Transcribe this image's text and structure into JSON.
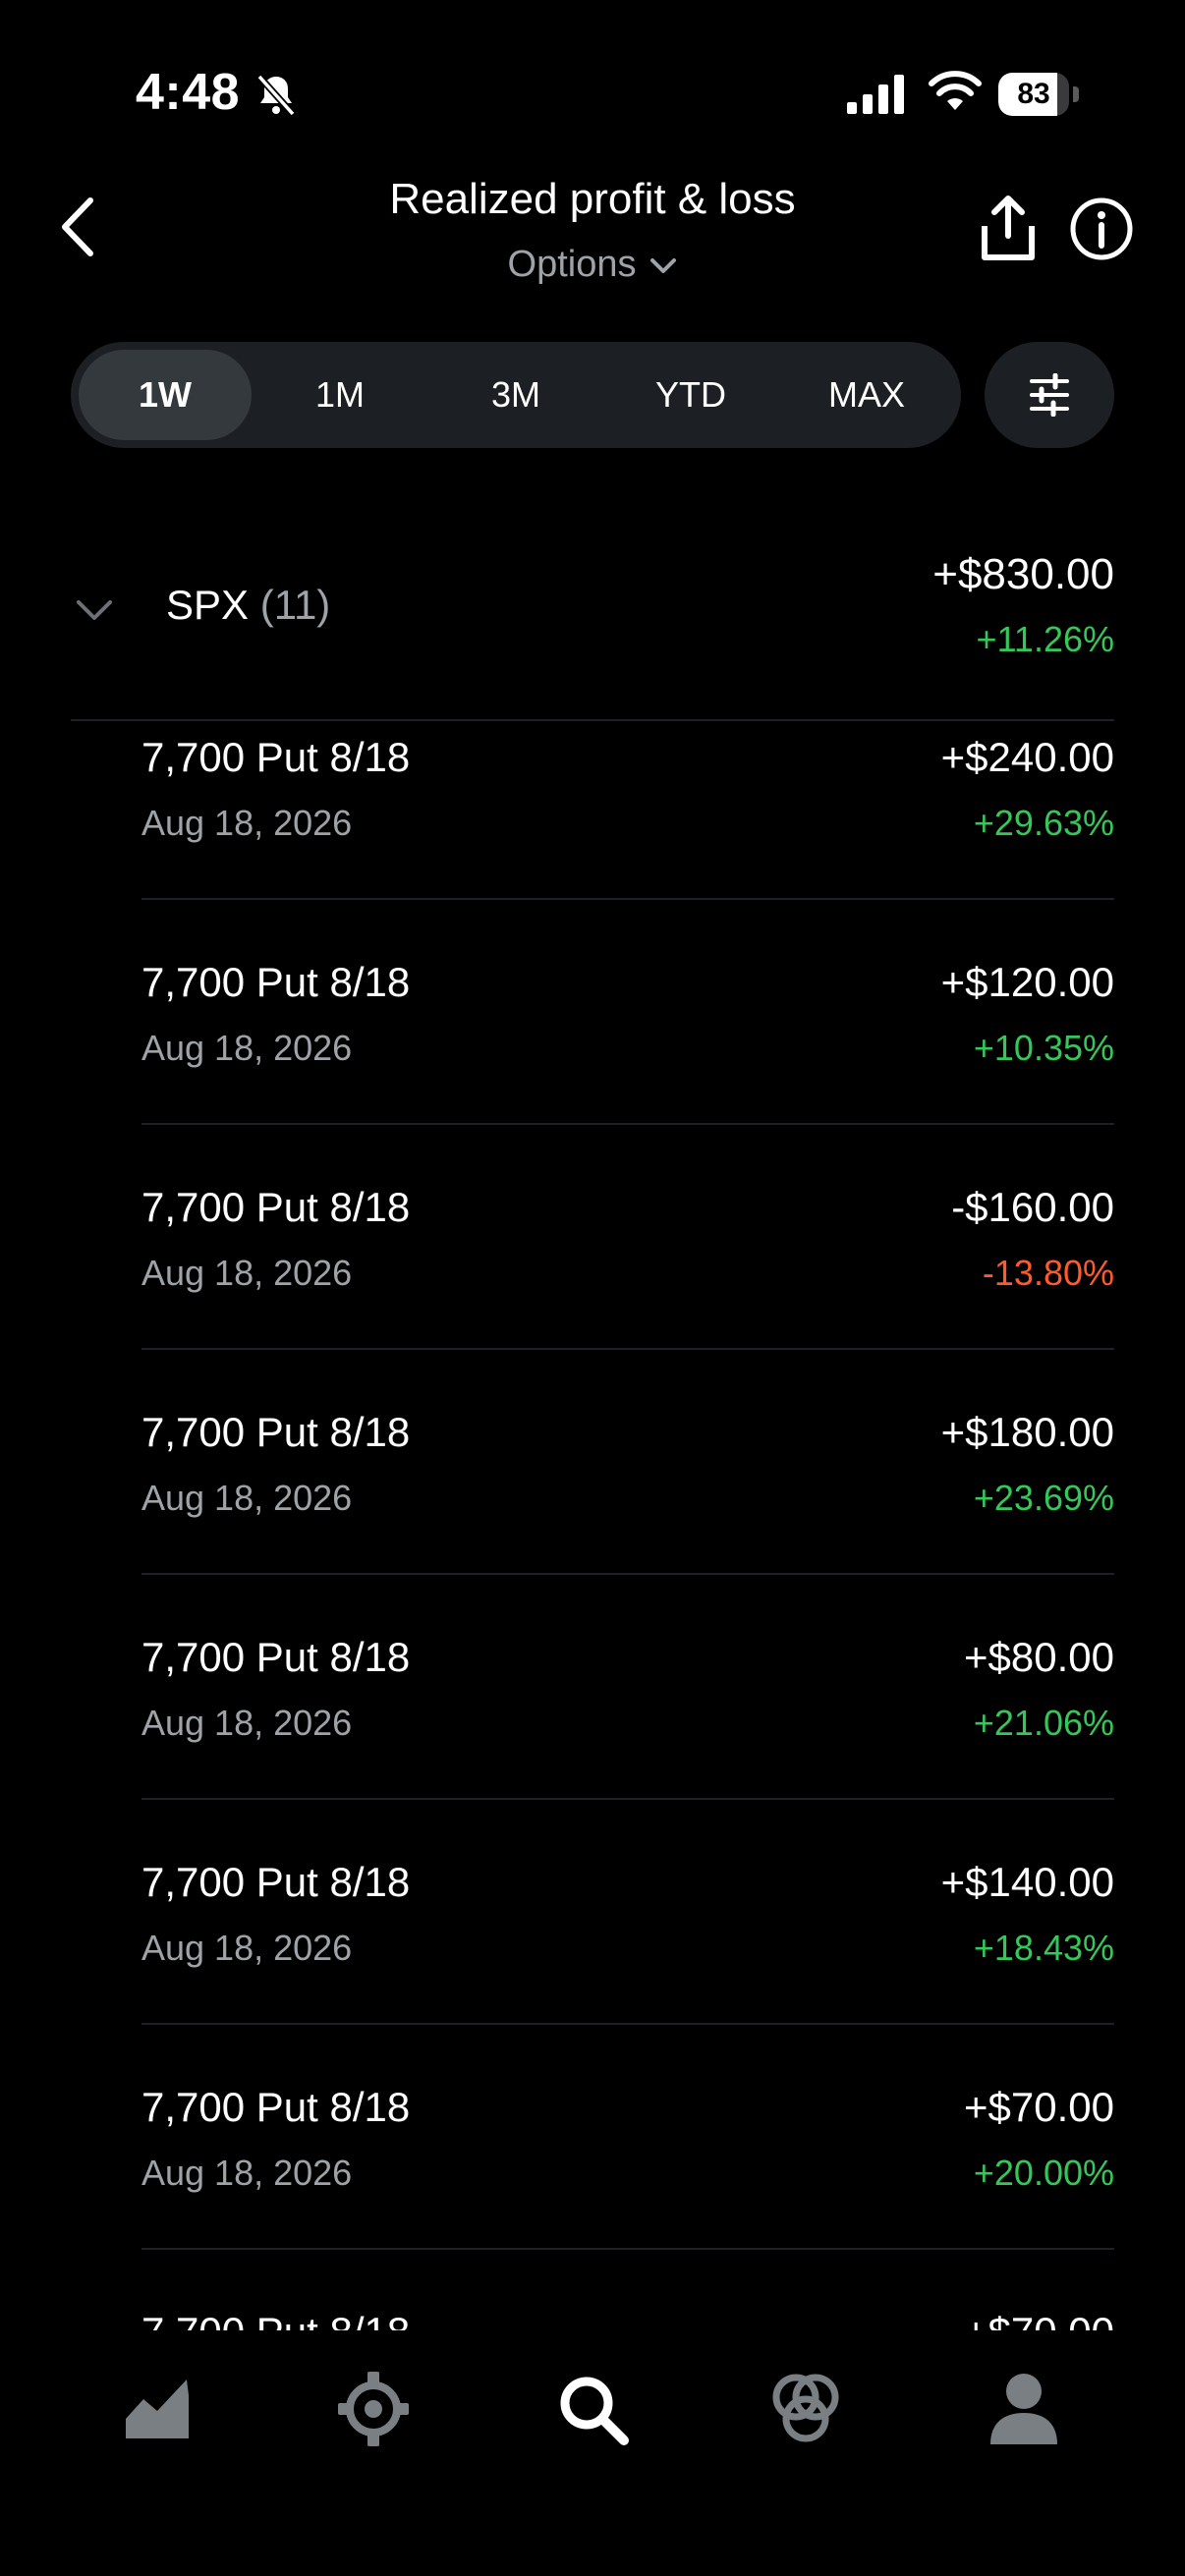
{
  "status_bar": {
    "time": "4:48",
    "battery": "83"
  },
  "header": {
    "title": "Realized profit & loss",
    "subtitle": "Options"
  },
  "periods": [
    "1W",
    "1M",
    "3M",
    "YTD",
    "MAX"
  ],
  "active_period": "1W",
  "group": {
    "symbol": "SPX",
    "count": "(11)",
    "total": "+$830.00",
    "percent": "+11.26%"
  },
  "rows": [
    {
      "title": "7,700 Put 8/18",
      "date": "Aug 18, 2026",
      "amount": "+$240.00",
      "percent": "+29.63%",
      "sign": "pos"
    },
    {
      "title": "7,700 Put 8/18",
      "date": "Aug 18, 2026",
      "amount": "+$120.00",
      "percent": "+10.35%",
      "sign": "pos"
    },
    {
      "title": "7,700 Put 8/18",
      "date": "Aug 18, 2026",
      "amount": "-$160.00",
      "percent": "-13.80%",
      "sign": "neg"
    },
    {
      "title": "7,700 Put 8/18",
      "date": "Aug 18, 2026",
      "amount": "+$180.00",
      "percent": "+23.69%",
      "sign": "pos"
    },
    {
      "title": "7,700 Put 8/18",
      "date": "Aug 18, 2026",
      "amount": "+$80.00",
      "percent": "+21.06%",
      "sign": "pos"
    },
    {
      "title": "7,700 Put 8/18",
      "date": "Aug 18, 2026",
      "amount": "+$140.00",
      "percent": "+18.43%",
      "sign": "pos"
    },
    {
      "title": "7,700 Put 8/18",
      "date": "Aug 18, 2026",
      "amount": "+$70.00",
      "percent": "+20.00%",
      "sign": "pos"
    },
    {
      "title": "7,700 Put 8/18",
      "date": "",
      "amount": "+$70.00",
      "percent": "",
      "sign": "pos"
    }
  ],
  "colors": {
    "positive": "#35c759",
    "negative": "#ff5a2a",
    "muted": "#9ea3a8"
  },
  "nav": [
    "chart-icon",
    "scope-icon",
    "search-icon",
    "rings-icon",
    "profile-icon"
  ]
}
